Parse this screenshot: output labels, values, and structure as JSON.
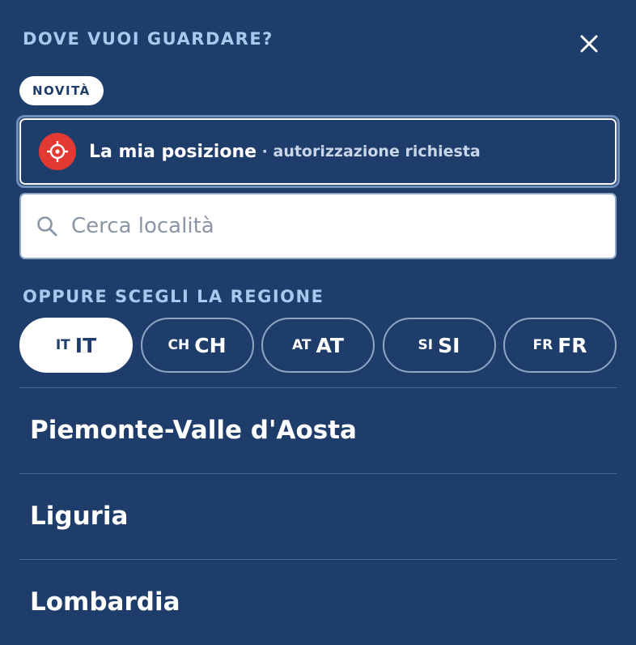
{
  "header": {
    "title": "DOVE VUOI GUARDARE?",
    "close_icon": "close-icon"
  },
  "badge": {
    "label": "NOVITÀ"
  },
  "location": {
    "label": "La mia posizione",
    "sublabel": "· autorizzazione richiesta",
    "icon": "crosshair-icon",
    "icon_color": "#e23a32"
  },
  "search": {
    "placeholder": "Cerca località",
    "icon": "search-icon"
  },
  "region_section": {
    "title": "OPPURE SCEGLI LA REGIONE"
  },
  "countries": [
    {
      "flag": "IT",
      "code": "IT",
      "selected": true
    },
    {
      "flag": "CH",
      "code": "CH",
      "selected": false
    },
    {
      "flag": "AT",
      "code": "AT",
      "selected": false
    },
    {
      "flag": "SI",
      "code": "SI",
      "selected": false
    },
    {
      "flag": "FR",
      "code": "FR",
      "selected": false
    }
  ],
  "regions": [
    "Piemonte-Valle d'Aosta",
    "Liguria",
    "Lombardia"
  ],
  "colors": {
    "background": "#1e3d6b",
    "heading": "#a9c8ee",
    "accent_red": "#e23a32"
  }
}
